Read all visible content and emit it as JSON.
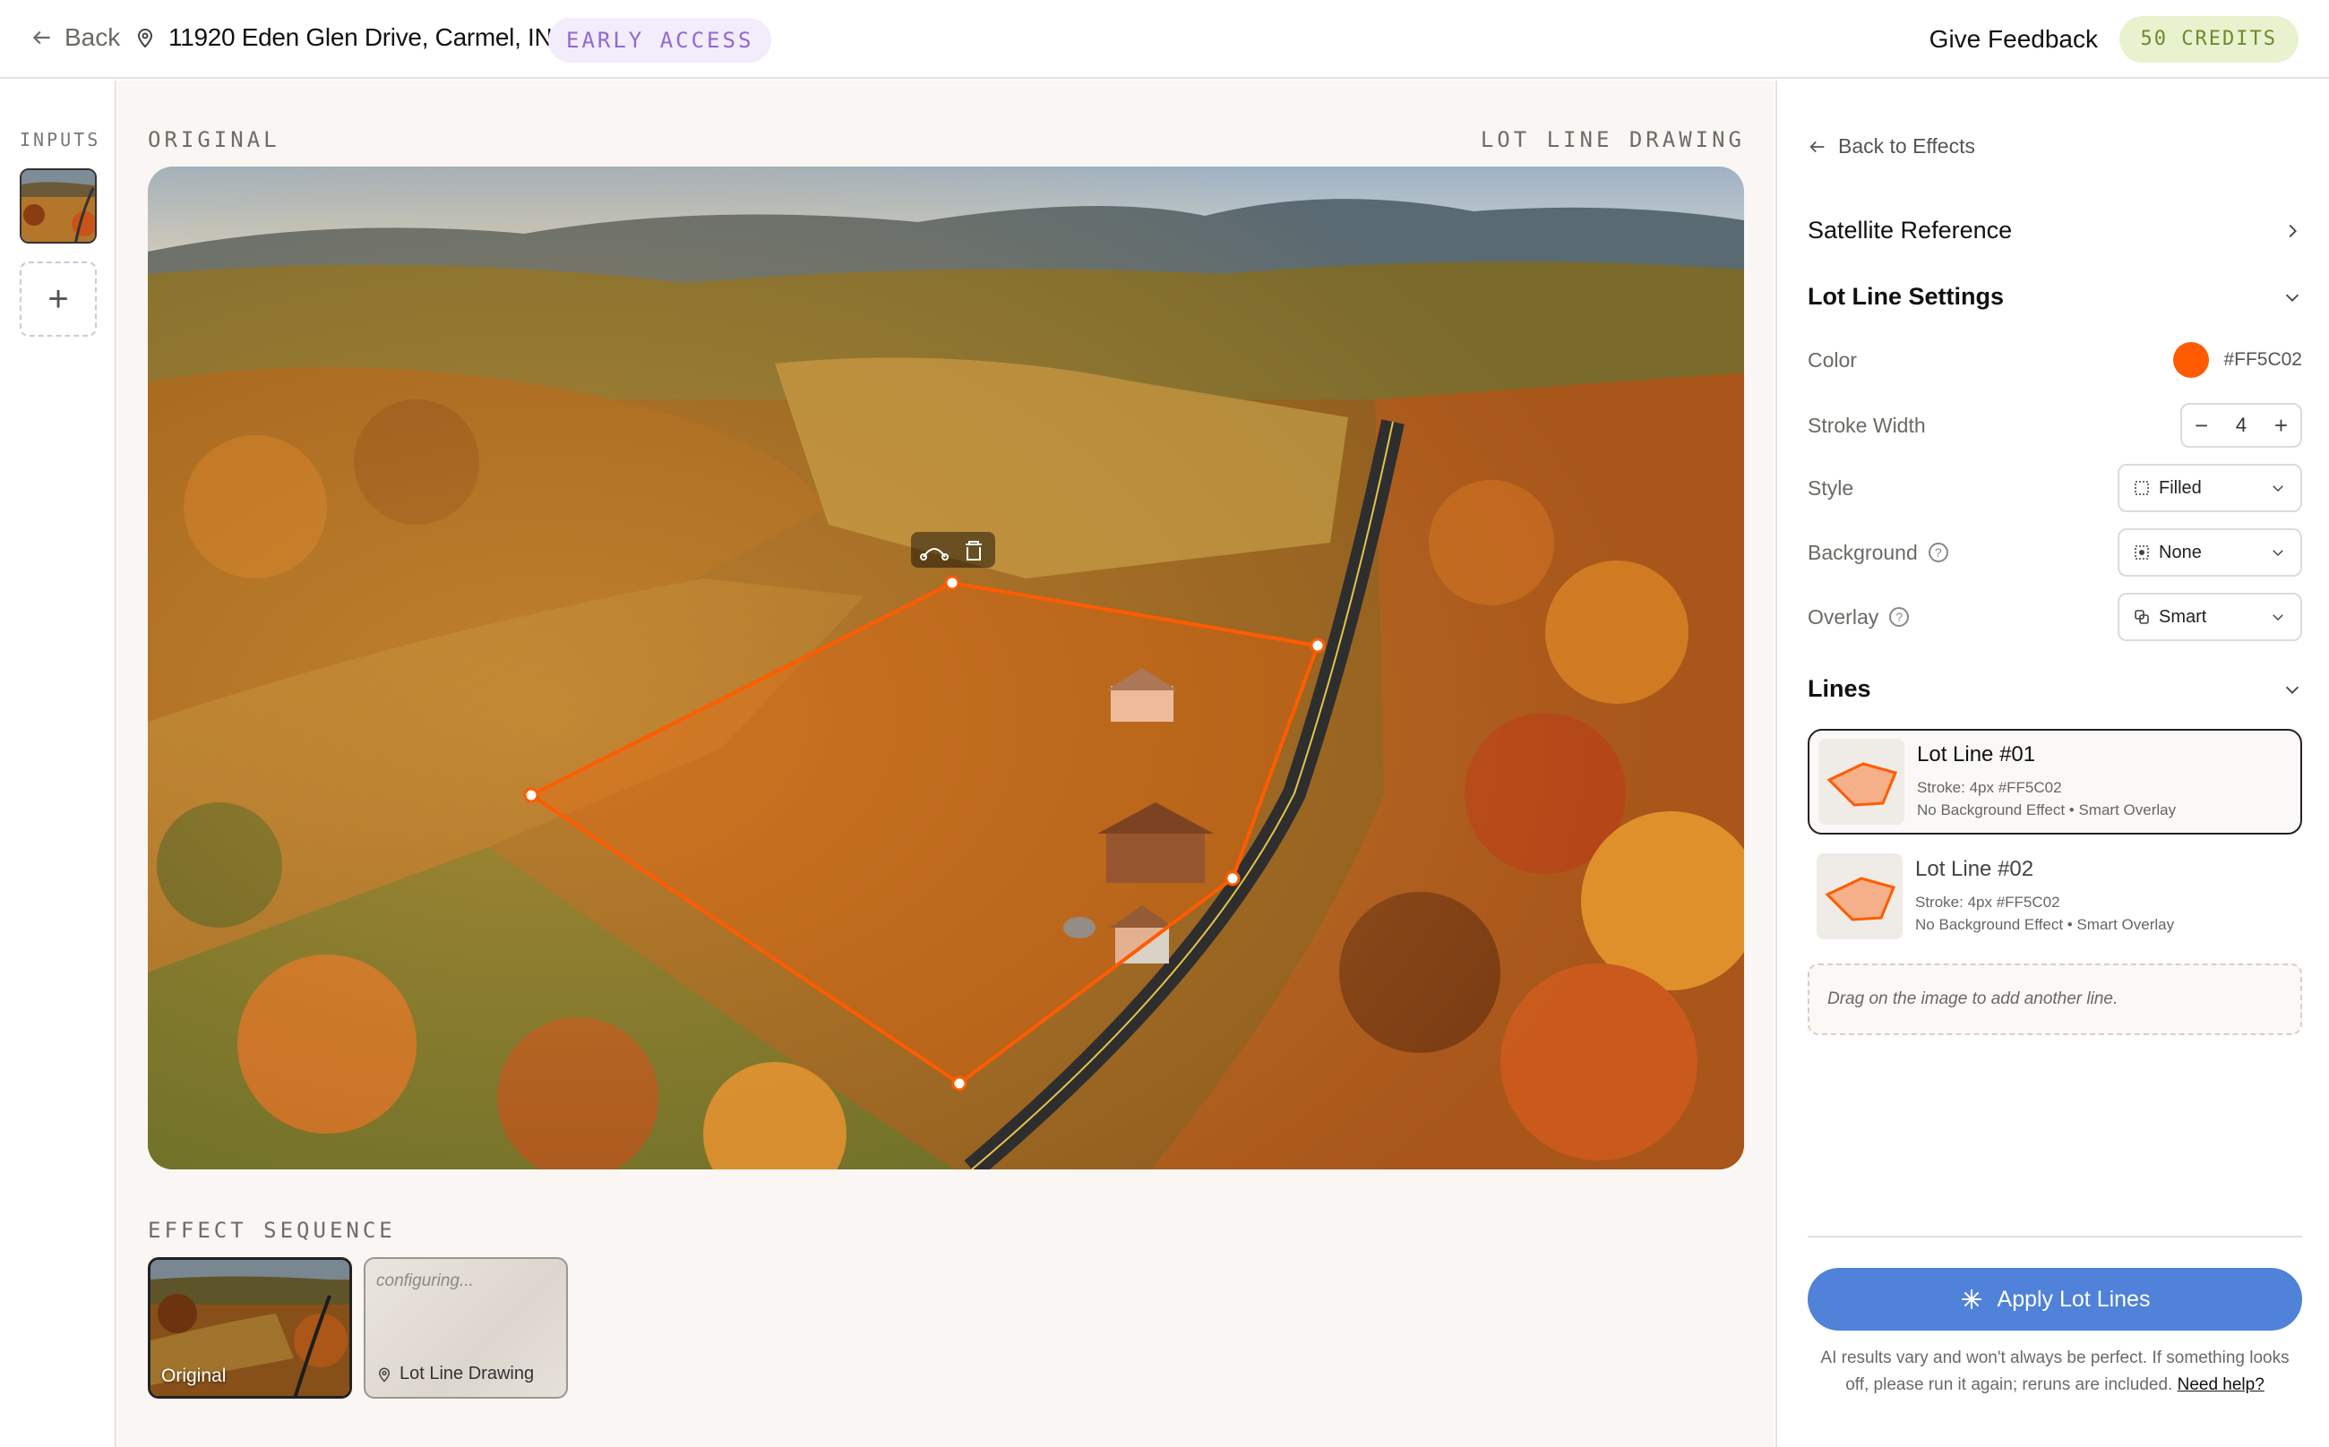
{
  "header": {
    "back_label": "Back",
    "address": "11920 Eden Glen Drive, Carmel, IN",
    "badge": "EARLY ACCESS",
    "feedback": "Give Feedback",
    "credits": "50 CREDITS"
  },
  "rail": {
    "label": "INPUTS"
  },
  "canvas": {
    "left_label": "ORIGINAL",
    "right_label": "LOT LINE DRAWING"
  },
  "sequence": {
    "label": "EFFECT SEQUENCE",
    "items": [
      {
        "caption": "Original"
      },
      {
        "status": "configuring...",
        "caption": "Lot Line Drawing"
      }
    ]
  },
  "panel": {
    "back_label": "Back to Effects",
    "satellite": "Satellite Reference",
    "settings_title": "Lot Line Settings",
    "color_label": "Color",
    "color_hex": "#FF5C02",
    "stroke_label": "Stroke Width",
    "stroke_value": "4",
    "style_label": "Style",
    "style_value": "Filled",
    "background_label": "Background",
    "background_value": "None",
    "overlay_label": "Overlay",
    "overlay_value": "Smart",
    "lines_title": "Lines",
    "lines": [
      {
        "title": "Lot Line #01",
        "stroke": "Stroke: 4px #FF5C02",
        "detail": "No Background Effect • Smart Overlay"
      },
      {
        "title": "Lot Line #02",
        "stroke": "Stroke: 4px #FF5C02",
        "detail": "No Background Effect • Smart Overlay"
      }
    ],
    "dropzone": "Drag on the image to add another line.",
    "apply": "Apply Lot Lines",
    "disclaimer": "AI results vary and won't always be perfect. If something looks off, please run it again; reruns are included.",
    "help": "Need help?"
  },
  "colors": {
    "accent": "#FF5C02",
    "primary_button": "#4f82d8",
    "badge_bg": "#f2ecfb",
    "credits_bg": "#e9f2cf"
  }
}
